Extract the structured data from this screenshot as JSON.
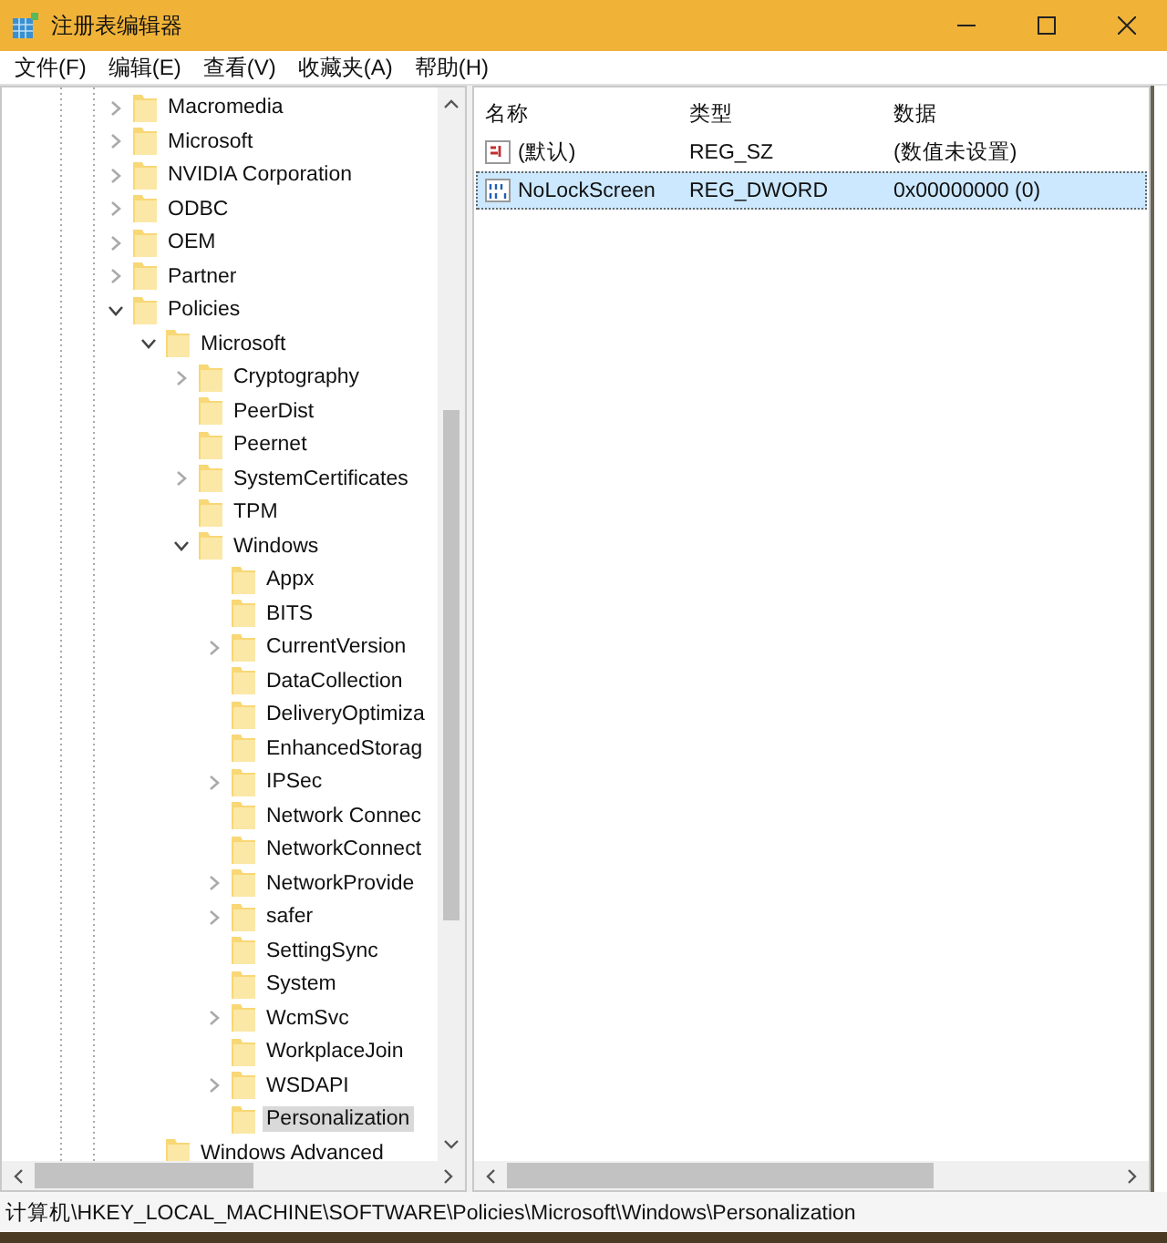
{
  "window": {
    "title": "注册表编辑器"
  },
  "menu": [
    "文件(F)",
    "编辑(E)",
    "查看(V)",
    "收藏夹(A)",
    "帮助(H)"
  ],
  "tree": [
    {
      "label": "Macromedia",
      "expanded": false,
      "selected": false
    },
    {
      "label": "Microsoft",
      "expanded": false,
      "selected": false
    },
    {
      "label": "NVIDIA Corporation",
      "expanded": false,
      "selected": false
    },
    {
      "label": "ODBC",
      "expanded": false,
      "selected": false
    },
    {
      "label": "OEM",
      "expanded": false,
      "selected": false
    },
    {
      "label": "Partner",
      "expanded": false,
      "selected": false
    },
    {
      "label": "Policies",
      "expanded": true,
      "selected": false,
      "children": [
        {
          "label": "Microsoft",
          "expanded": true,
          "selected": false,
          "children": [
            {
              "label": "Cryptography",
              "expanded": false,
              "selected": false
            },
            {
              "label": "PeerDist",
              "selected": false
            },
            {
              "label": "Peernet",
              "selected": false
            },
            {
              "label": "SystemCertificates",
              "expanded": false,
              "selected": false
            },
            {
              "label": "TPM",
              "selected": false
            },
            {
              "label": "Windows",
              "expanded": true,
              "selected": false,
              "children": [
                {
                  "label": "Appx",
                  "selected": false
                },
                {
                  "label": "BITS",
                  "selected": false
                },
                {
                  "label": "CurrentVersion",
                  "expanded": false,
                  "selected": false
                },
                {
                  "label": "DataCollection",
                  "selected": false
                },
                {
                  "label": "DeliveryOptimiza",
                  "selected": false
                },
                {
                  "label": "EnhancedStorag",
                  "selected": false
                },
                {
                  "label": "IPSec",
                  "expanded": false,
                  "selected": false
                },
                {
                  "label": "Network Connec",
                  "selected": false
                },
                {
                  "label": "NetworkConnect",
                  "selected": false
                },
                {
                  "label": "NetworkProvide",
                  "expanded": false,
                  "selected": false
                },
                {
                  "label": "safer",
                  "expanded": false,
                  "selected": false
                },
                {
                  "label": "SettingSync",
                  "selected": false
                },
                {
                  "label": "System",
                  "selected": false
                },
                {
                  "label": "WcmSvc",
                  "expanded": false,
                  "selected": false
                },
                {
                  "label": "WorkplaceJoin",
                  "selected": false
                },
                {
                  "label": "WSDAPI",
                  "expanded": false,
                  "selected": false
                },
                {
                  "label": "Personalization",
                  "selected": true
                }
              ]
            }
          ]
        },
        {
          "label": "Windows Advanced",
          "selected": false
        }
      ]
    }
  ],
  "values": {
    "columns": [
      "名称",
      "类型",
      "数据"
    ],
    "rows": [
      {
        "kind": "string",
        "name": "(默认)",
        "type": "REG_SZ",
        "data": "(数值未设置)",
        "selected": false
      },
      {
        "kind": "dword",
        "name": "NoLockScreen",
        "type": "REG_DWORD",
        "data": "0x00000000 (0)",
        "selected": true
      }
    ]
  },
  "status_bar": "计算机\\HKEY_LOCAL_MACHINE\\SOFTWARE\\Policies\\Microsoft\\Windows\\Personalization"
}
